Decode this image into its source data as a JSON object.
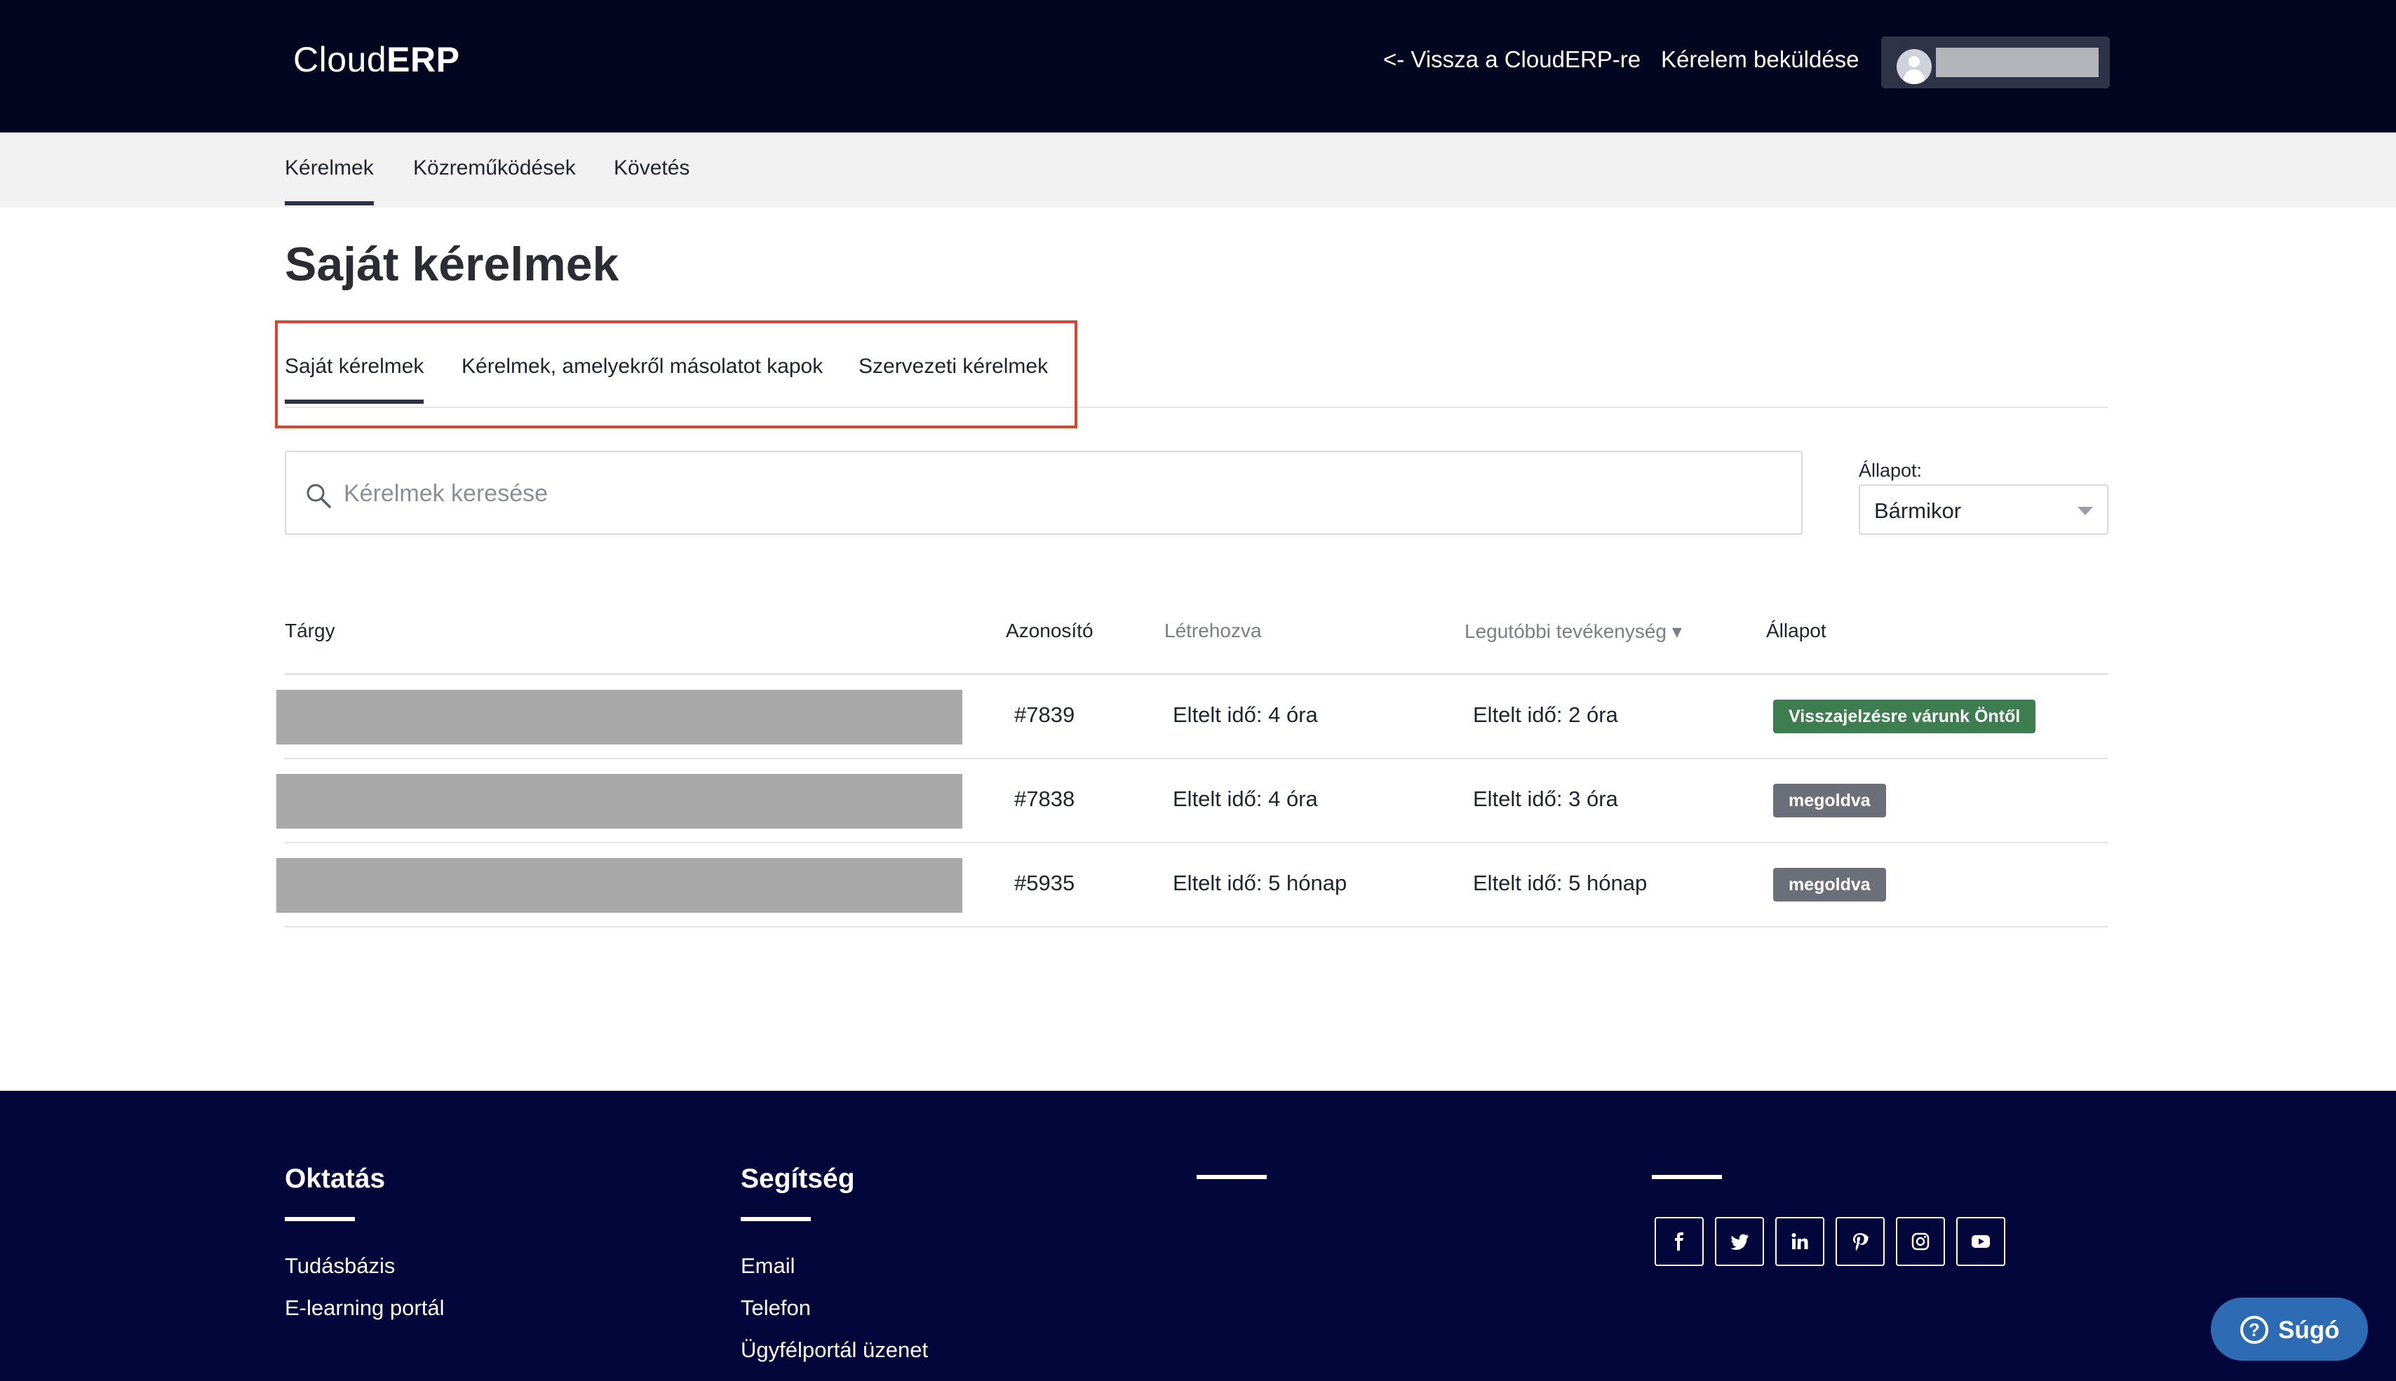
{
  "header": {
    "logo_part1": "Cloud",
    "logo_part2": "ERP",
    "back_link": "<- Vissza a CloudERP-re",
    "submit_link": "Kérelem beküldése"
  },
  "subnav": {
    "items": [
      {
        "label": "Kérelmek",
        "active": true
      },
      {
        "label": "Közreműködések",
        "active": false
      },
      {
        "label": "Követés",
        "active": false
      }
    ]
  },
  "page_title": "Saját kérelmek",
  "tabs": [
    {
      "label": "Saját kérelmek",
      "active": true
    },
    {
      "label": "Kérelmek, amelyekről másolatot kapok",
      "active": false
    },
    {
      "label": "Szervezeti kérelmek",
      "active": false
    }
  ],
  "search": {
    "placeholder": "Kérelmek keresése",
    "value": ""
  },
  "status_filter": {
    "label": "Állapot:",
    "selected": "Bármikor"
  },
  "table": {
    "columns": [
      "Tárgy",
      "Azonosító",
      "Létrehozva",
      "Legutóbbi tevékenység ▾",
      "Állapot"
    ],
    "rows": [
      {
        "id": "#7839",
        "created": "Eltelt idő: 4 óra",
        "activity": "Eltelt idő: 2 óra",
        "status": "Visszajelzésre várunk Öntől",
        "status_color": "#3e7d4f"
      },
      {
        "id": "#7838",
        "created": "Eltelt idő: 4 óra",
        "activity": "Eltelt idő: 3 óra",
        "status": "megoldva",
        "status_color": "#6b6f7a"
      },
      {
        "id": "#5935",
        "created": "Eltelt idő: 5 hónap",
        "activity": "Eltelt idő: 5 hónap",
        "status": "megoldva",
        "status_color": "#6b6f7a"
      }
    ]
  },
  "footer": {
    "col1": {
      "title": "Oktatás",
      "links": [
        "Tudásbázis",
        "E-learning portál"
      ]
    },
    "col2": {
      "title": "Segítség",
      "links": [
        "Email",
        "Telefon",
        "Ügyfélportál üzenet"
      ]
    },
    "social": [
      "facebook-icon",
      "twitter-icon",
      "linkedin-icon",
      "pinterest-icon",
      "instagram-icon",
      "youtube-icon"
    ]
  },
  "help_button": "Súgó",
  "colors": {
    "header_bg": "#03061f",
    "footer_bg": "#03063a",
    "tab_highlight": "#e0422c",
    "badge_waiting": "#3e7d4f",
    "badge_resolved": "#6b6f7a",
    "help_button": "#2d6cb5"
  }
}
